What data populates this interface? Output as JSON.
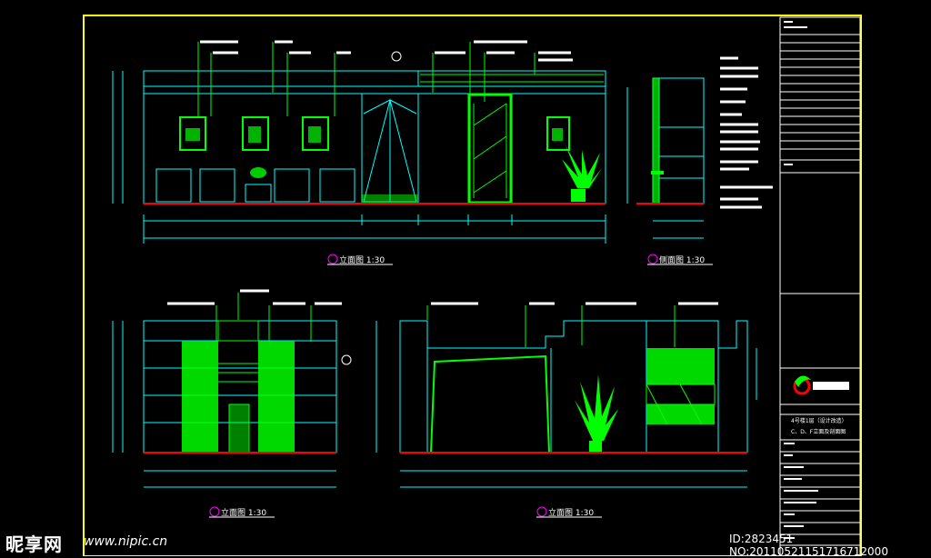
{
  "drawing": {
    "views": [
      {
        "key": "v1",
        "title": "立面图 1:30"
      },
      {
        "key": "v2",
        "title": "侧面图 1:30"
      },
      {
        "key": "v3",
        "title": "立面图 1:30"
      },
      {
        "key": "v4",
        "title": "立面图 1:30"
      }
    ],
    "title_block": {
      "project": "4号楼1层（设计改造）",
      "sheet": "C、D、F立面及剖面图"
    }
  },
  "watermark": {
    "logo": "昵享网",
    "url": "www.nipic.cn",
    "id": "ID:2823451 NO:20110521151716712000"
  },
  "colors": {
    "background": "#000000",
    "frame": "#ffff00",
    "outline": "#00ffff",
    "detail": "#00ff00",
    "floor": "#ff0000",
    "accent": "#ff00ff",
    "text": "#ffffff"
  }
}
